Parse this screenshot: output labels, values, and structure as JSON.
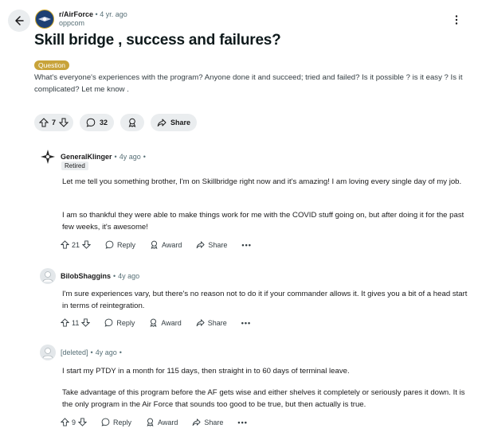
{
  "post": {
    "subreddit": "r/AirForce",
    "separator": "•",
    "age": "4 yr. ago",
    "author": "oppcom",
    "title": "Skill bridge , success and failures?",
    "flair": "Question",
    "body": "What's everyone's experiences with the program? Anyone done it and succeed; tried and failed? Is it possible ? is it easy ? Is it complicated? Let me know .",
    "votes": "7",
    "comments": "32",
    "share_label": "Share"
  },
  "comments": [
    {
      "author": "GeneralKlinger",
      "age": "4y ago",
      "sep": "•",
      "flair": "Retired",
      "paragraphs": [
        "Let me tell you something brother, I'm on Skillbridge right now and it's amazing! I am loving every single day of my job.",
        "I am so thankful they were able to make things work for me with the COVID stuff going on, but after doing it for the past few weeks, it's awesome!"
      ],
      "votes": "21"
    },
    {
      "author": "BilobShaggins",
      "age": "4y ago",
      "sep": "•",
      "paragraphs": [
        "I'm sure experiences vary, but there's no reason not to do it if your commander allows it. It gives you a bit of a head start in terms of reintegration."
      ],
      "votes": "11"
    },
    {
      "author": "[deleted]",
      "age": "4y ago",
      "sep": "•",
      "paragraphs": [
        "I start my PTDY in a month for 115 days, then straight in to 60 days of terminal leave.",
        "Take advantage of this program before the AF gets wise and either shelves it completely or seriously pares it down. It is the only program in the Air Force that sounds too good to be true, but then actually is true."
      ],
      "votes": "9"
    }
  ],
  "comment_actions": {
    "reply": "Reply",
    "award": "Award",
    "share": "Share",
    "more": "•••"
  },
  "icons": {
    "back": "arrow-left-icon",
    "more": "vertical-dots-icon",
    "upvote": "upvote-arrow-icon",
    "downvote": "downvote-arrow-icon",
    "comment": "speech-bubble-icon",
    "award": "award-ribbon-icon",
    "share": "share-arrow-icon"
  },
  "colors": {
    "flair_bg": "#c8a33a",
    "pill_bg": "#eaedef",
    "subreddit_avatar": "#1c3f73"
  }
}
